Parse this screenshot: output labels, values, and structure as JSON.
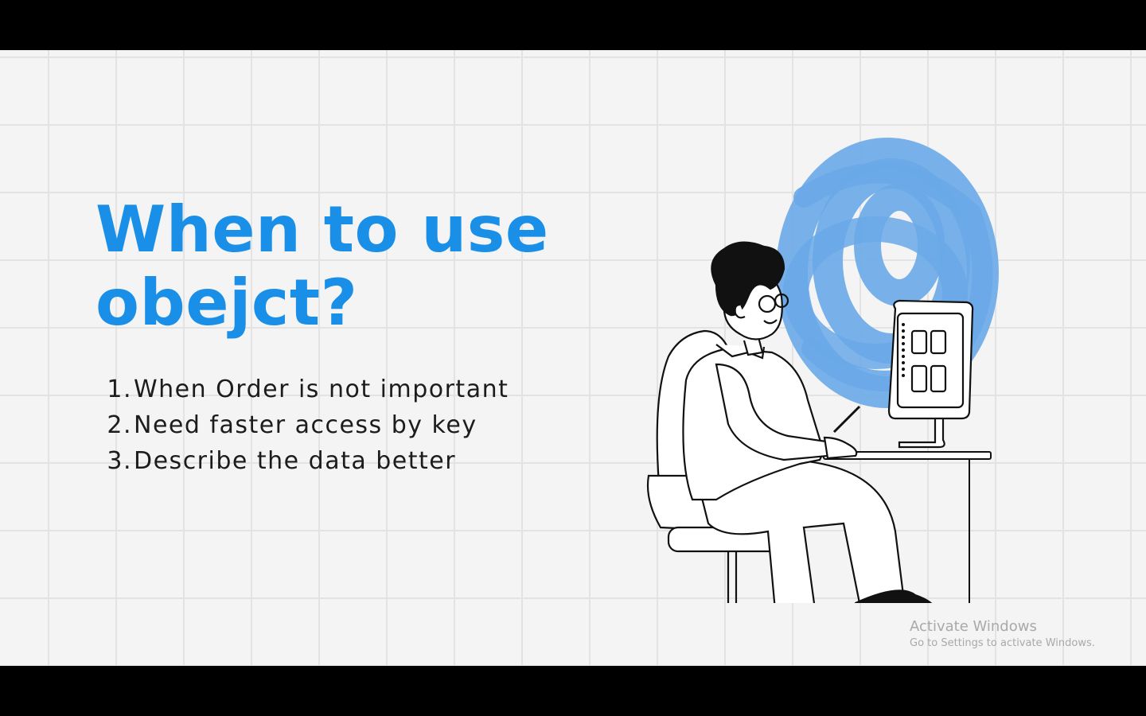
{
  "slide": {
    "title_line1": "When to use",
    "title_line2": "obejct?",
    "points": [
      {
        "number": "1.",
        "text": "When Order is not important"
      },
      {
        "number": "2.",
        "text": "Need faster access by key"
      },
      {
        "number": "3.",
        "text": "Describe the data better"
      }
    ],
    "illustration_icon": "person-at-computer-icon"
  },
  "watermark": {
    "title": "Activate Windows",
    "subtitle": "Go to Settings to activate Windows."
  },
  "colors": {
    "title": "#1a8fe8",
    "scribble": "#6aa8e8",
    "background": "#f4f4f4",
    "text": "#1c1c1c"
  }
}
